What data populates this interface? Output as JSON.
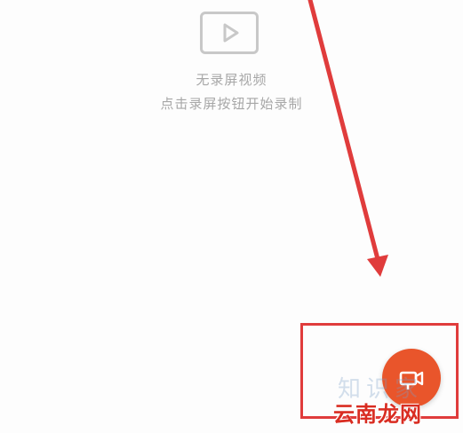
{
  "empty_state": {
    "title": "无录屏视频",
    "subtitle": "点击录屏按钮开始录制",
    "icon": "video-play-icon"
  },
  "record_button": {
    "icon": "video-camera-icon",
    "color": "#e9552b"
  },
  "annotation": {
    "arrow_color": "#e03c3c",
    "box_color": "#e03c3c"
  },
  "watermarks": {
    "top": "知识家",
    "bottom": "云南龙网"
  },
  "colors": {
    "background": "#fdfdfd",
    "muted_text": "#a7a7a7",
    "placeholder_border": "#c8c8c8"
  }
}
